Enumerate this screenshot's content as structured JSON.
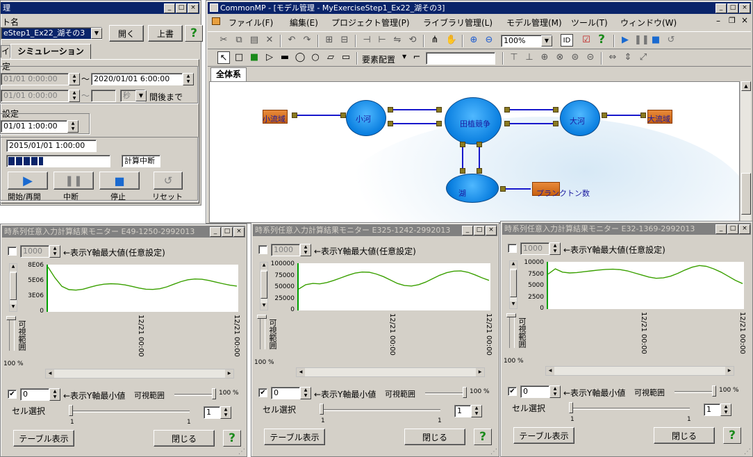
{
  "colors": {
    "title_active": "#0a246a",
    "title_inactive": "#808080",
    "node_blue": "#0a7fe0",
    "link": "#1818cc",
    "port": "#8a7a20",
    "chart_line": "#3aa000",
    "chart_axis": "#00a000"
  },
  "left_window": {
    "title": "理",
    "model_name_label": "ト名",
    "project_select": "eStep1_Ex22_湖その3",
    "open_button": "開く",
    "overwrite_button": "上書",
    "help": "?",
    "tabs": [
      "イ",
      "シミュレーション"
    ],
    "group1_label": "定",
    "start_time": "01/01  0:00:00",
    "end_time": "2020/01/01  6:00:00",
    "wave": "～",
    "time2": "01/01  0:00:00",
    "unit": "秒",
    "until_label": "間後まで",
    "group2_label": "設定",
    "step_time": "01/01  1:00:00",
    "current_time": "2015/01/01 1:00:00",
    "status": "計算中断",
    "progress": 0.35,
    "play_label": "開始/再開",
    "pause_label": "中断",
    "stop_label": "停止",
    "reset_label": "リセット"
  },
  "main_window": {
    "title": "CommonMP - [モデル管理 - MyExerciseStep1_Ex22_湖その3]",
    "menu": [
      "ファイル(F)",
      "編集(E)",
      "プロジェクト管理(P)",
      "ライブラリ管理(L)",
      "モデル管理(M)",
      "ツール(T)",
      "ウィンドウ(W)"
    ],
    "zoom": "100%",
    "layout_label": "要素配置",
    "help": "?",
    "tab": "全体系",
    "nodes": [
      {
        "name": "small-sensor",
        "label": "小流域"
      },
      {
        "name": "small-river",
        "label": "小河"
      },
      {
        "name": "lake",
        "label": "田植競争"
      },
      {
        "name": "large-river",
        "label": "大河"
      },
      {
        "name": "large-sensor",
        "label": "大流域"
      },
      {
        "name": "pond",
        "label": "湖"
      },
      {
        "name": "plankton",
        "label": "プランクトン数"
      }
    ]
  },
  "monitors": [
    {
      "title": "時系列任意入力計算結果モニター E49-1250-2992013",
      "ymax_value": "1000",
      "ymax_label": "←表示Y軸最大値(任意設定)",
      "yticks": [
        "8E06",
        "5E06",
        "3E06",
        "0"
      ],
      "xticks": [
        "12/21 00:00",
        "12/21 00:00"
      ],
      "range_label": "可視範囲",
      "pct": "100 %",
      "ymin_value": "0",
      "ymin_label": "←表示Y軸最小値",
      "visible_range": "可視範囲",
      "range_pct": "100 %",
      "cell_label": "セル選択",
      "cell_value": "1",
      "cell_min": "1",
      "cell_max": "1",
      "table_button": "テーブル表示",
      "close_button": "閉じる",
      "help": "?",
      "chart_data": {
        "type": "line",
        "ylim": [
          0,
          10000000
        ],
        "values": [
          9500000,
          7200000,
          5400000,
          4700000,
          4600000,
          4800000,
          5200000,
          5600000,
          5850000,
          5950000,
          5900000,
          5700000,
          5400000,
          5050000,
          4800000,
          4750000,
          4900000,
          5300000,
          5850000,
          6400000,
          6800000,
          6950000,
          6900000,
          6650000,
          6300000,
          5950000,
          5650000,
          5450000
        ]
      }
    },
    {
      "title": "時系列任意入力計算結果モニター E325-1242-2992013",
      "ymax_value": "1000",
      "ymax_label": "←表示Y軸最大値(任意設定)",
      "yticks": [
        "100000",
        "75000",
        "50000",
        "25000",
        "0"
      ],
      "xticks": [
        "12/21 00:00",
        "12/21 00:00"
      ],
      "range_label": "可視範囲",
      "pct": "100 %",
      "ymin_value": "0",
      "ymin_label": "←表示Y軸最小値",
      "visible_range": "可視範囲",
      "range_pct": "100 %",
      "cell_label": "セル選択",
      "cell_value": "1",
      "cell_min": "1",
      "cell_max": "1",
      "table_button": "テーブル表示",
      "close_button": "閉じる",
      "help": "?",
      "chart_data": {
        "type": "line",
        "ylim": [
          0,
          110000
        ],
        "values": [
          50000,
          60000,
          63000,
          62000,
          65000,
          70000,
          76000,
          82000,
          87000,
          89500,
          89000,
          85000,
          79000,
          71000,
          63000,
          58000,
          57000,
          60000,
          66000,
          74000,
          82000,
          88000,
          91500,
          92000,
          89000,
          83000,
          76000,
          70000
        ]
      }
    },
    {
      "title": "時系列任意入力計算結果モニター E32-1369-2992013",
      "ymax_value": "1000",
      "ymax_label": "←表示Y軸最大値(任意設定)",
      "yticks": [
        "10000",
        "7500",
        "5000",
        "2500",
        "0"
      ],
      "xticks": [
        "12/21 00:00",
        "12/21 00:00"
      ],
      "range_label": "可視範囲",
      "pct": "100 %",
      "ymin_value": "0",
      "ymin_label": "←表示Y軸最小値",
      "visible_range": "可視範囲",
      "range_pct": "100 %",
      "cell_label": "セル選択",
      "cell_value": "1",
      "cell_min": "1",
      "cell_max": "1",
      "table_button": "テーブル表示",
      "close_button": "閉じる",
      "help": "?",
      "chart_data": {
        "type": "line",
        "ylim": [
          0,
          11500
        ],
        "values": [
          8500,
          9800,
          9000,
          8800,
          8900,
          9100,
          9300,
          9500,
          9650,
          9700,
          9600,
          9300,
          8800,
          8300,
          7800,
          7500,
          7600,
          8000,
          8700,
          9500,
          10200,
          10600,
          10400,
          9800,
          9000,
          8000,
          7000,
          6200
        ]
      }
    }
  ]
}
